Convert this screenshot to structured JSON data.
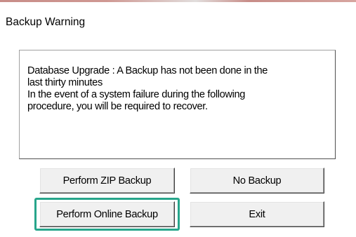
{
  "window": {
    "title": "Backup Warning",
    "accent_color": "#27a58b"
  },
  "message": {
    "lines": [
      "Database Upgrade : A Backup has not been done in the",
      "last thirty minutes",
      "In the event of a system failure during the following",
      "procedure, you will be required to recover."
    ]
  },
  "buttons": {
    "zip_backup": "Perform ZIP Backup",
    "no_backup": "No Backup",
    "online_backup": "Perform Online Backup",
    "exit": "Exit"
  },
  "highlighted_button": "online_backup"
}
